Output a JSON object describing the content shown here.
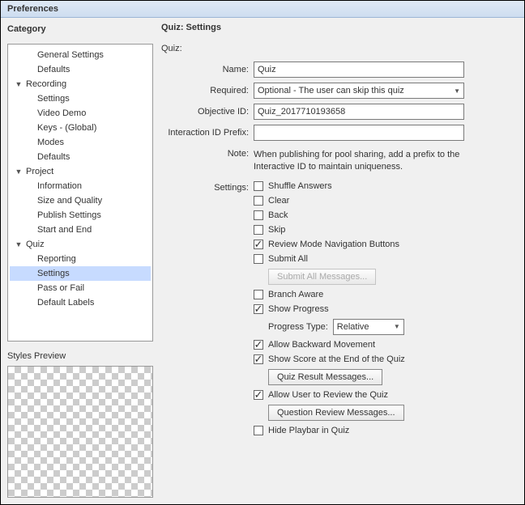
{
  "window": {
    "title": "Preferences"
  },
  "sidebar": {
    "heading": "Category",
    "items": [
      {
        "label": "General Settings",
        "type": "leaf",
        "level": 0
      },
      {
        "label": "Defaults",
        "type": "leaf",
        "level": 0
      },
      {
        "label": "Recording",
        "type": "group",
        "level": 0,
        "children": [
          {
            "label": "Settings"
          },
          {
            "label": "Video Demo"
          },
          {
            "label": "Keys - (Global)"
          },
          {
            "label": "Modes"
          },
          {
            "label": "Defaults"
          }
        ]
      },
      {
        "label": "Project",
        "type": "group",
        "level": 0,
        "children": [
          {
            "label": "Information"
          },
          {
            "label": "Size and Quality"
          },
          {
            "label": "Publish Settings"
          },
          {
            "label": "Start and End"
          }
        ]
      },
      {
        "label": "Quiz",
        "type": "group",
        "level": 0,
        "children": [
          {
            "label": "Reporting"
          },
          {
            "label": "Settings",
            "selected": true
          },
          {
            "label": "Pass or Fail"
          },
          {
            "label": "Default Labels"
          }
        ]
      }
    ],
    "styles_preview_label": "Styles Preview"
  },
  "page": {
    "title": "Quiz: Settings",
    "quiz_heading": "Quiz:",
    "fields": {
      "name_label": "Name:",
      "name_value": "Quiz",
      "required_label": "Required:",
      "required_value": "Optional - The user can skip this quiz",
      "objective_label": "Objective ID:",
      "objective_value": "Quiz_2017710193658",
      "interaction_label": "Interaction ID Prefix:",
      "interaction_value": "",
      "note_label": "Note:",
      "note_text": "When publishing for pool sharing, add a prefix to the Interactive ID to maintain uniqueness."
    },
    "settings_heading": "Settings:",
    "checks": {
      "shuffle": {
        "label": "Shuffle Answers",
        "checked": false
      },
      "clear": {
        "label": "Clear",
        "checked": false
      },
      "back": {
        "label": "Back",
        "checked": false
      },
      "skip": {
        "label": "Skip",
        "checked": false
      },
      "review_nav": {
        "label": "Review Mode Navigation Buttons",
        "checked": true
      },
      "submit_all": {
        "label": "Submit All",
        "checked": false
      },
      "branch_aware": {
        "label": "Branch Aware",
        "checked": false
      },
      "show_progress": {
        "label": "Show Progress",
        "checked": true
      },
      "allow_back": {
        "label": "Allow Backward Movement",
        "checked": true
      },
      "show_score": {
        "label": "Show Score at the End of the Quiz",
        "checked": true
      },
      "allow_review": {
        "label": "Allow User to Review the Quiz",
        "checked": true
      },
      "hide_playbar": {
        "label": "Hide Playbar in Quiz",
        "checked": false
      }
    },
    "buttons": {
      "submit_all_msgs": "Submit All Messages...",
      "quiz_result_msgs": "Quiz Result Messages...",
      "question_review_msgs": "Question Review Messages..."
    },
    "progress_type_label": "Progress Type:",
    "progress_type_value": "Relative"
  }
}
